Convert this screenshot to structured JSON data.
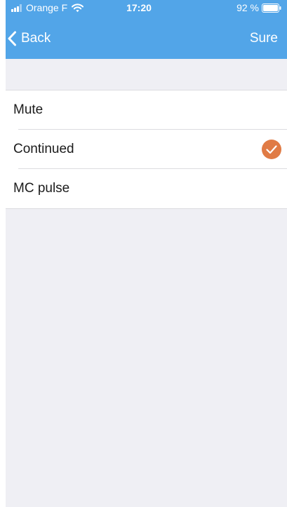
{
  "status_bar": {
    "carrier": "Orange F",
    "time": "17:20",
    "battery": "92 %",
    "icons": [
      "signal-icon",
      "wifi-icon",
      "battery-icon"
    ]
  },
  "nav": {
    "back_label": "Back",
    "confirm_label": "Sure",
    "back_icon": "chevron-left-icon"
  },
  "options": {
    "items": [
      {
        "label": "Mute",
        "selected": false
      },
      {
        "label": "Continued",
        "selected": true
      },
      {
        "label": "MC pulse",
        "selected": false
      }
    ],
    "check_icon": "check-circle-icon"
  },
  "colors": {
    "header": "#52a5e8",
    "background": "#efeff4",
    "check": "#e07b45",
    "text": "#1b1b1b"
  }
}
